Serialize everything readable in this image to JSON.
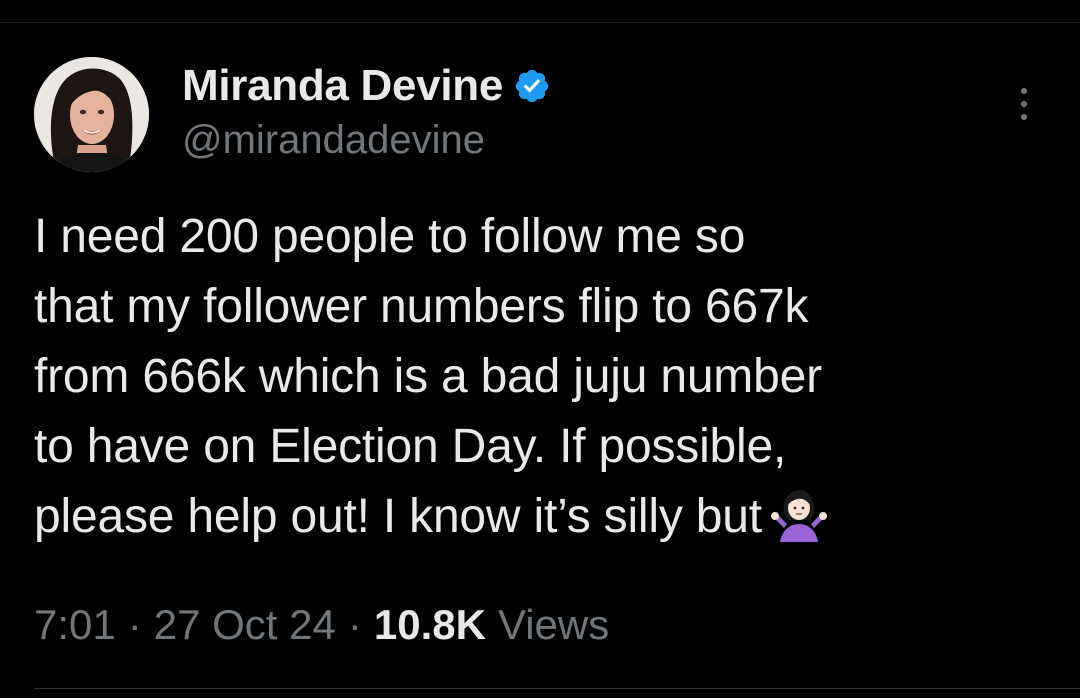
{
  "author": {
    "display_name": "Miranda Devine",
    "handle": "@mirandadevine",
    "verified_icon": "verified-badge-icon",
    "avatar_icon": "profile-photo"
  },
  "tweet": {
    "lines": [
      "I need 200 people to follow me so",
      "that my follower numbers flip to 667k",
      "from 666k which is a bad juju number",
      "to have on Election Day. If possible,",
      "please help out! I know it’s silly but"
    ],
    "emoji": "person-shrugging-emoji"
  },
  "meta": {
    "time": "7:01",
    "separator": "·",
    "date": "27 Oct 24",
    "views_count": "10.8K",
    "views_label": "Views"
  },
  "actions": {
    "more_icon": "more-options-icon"
  },
  "colors": {
    "background": "#000000",
    "primary_text": "#e7e9ea",
    "secondary_text": "#71767b",
    "verified_blue": "#1d9bf0",
    "divider": "#2f3336"
  }
}
